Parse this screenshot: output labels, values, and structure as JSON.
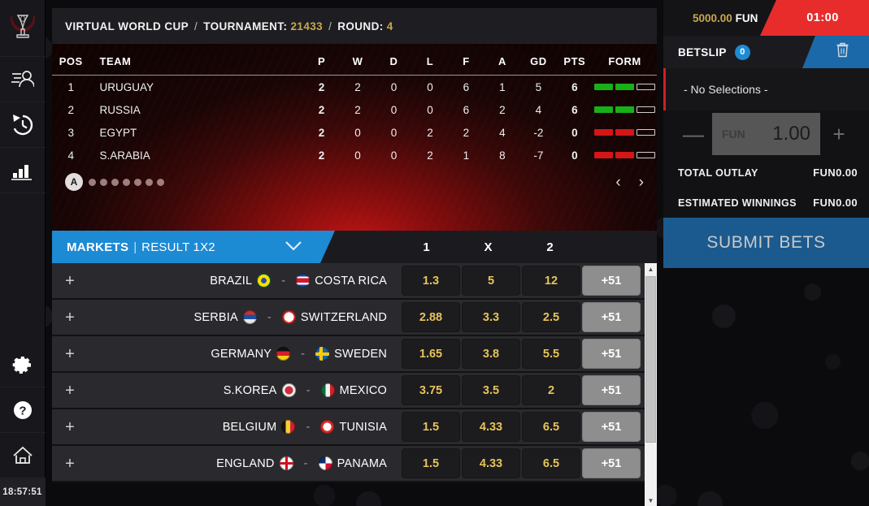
{
  "rail": {
    "items": [
      {
        "name": "trophy-icon",
        "label": "Virtual World Cup"
      },
      {
        "name": "lineups-icon",
        "label": "Line Ups"
      },
      {
        "name": "history-icon",
        "label": "History"
      },
      {
        "name": "statistics-icon",
        "label": "Statistics"
      },
      {
        "name": "settings-icon",
        "label": "Settings"
      },
      {
        "name": "help-icon",
        "label": "Help"
      },
      {
        "name": "home-icon",
        "label": "Home"
      }
    ],
    "clock": "18:57:51"
  },
  "header": {
    "title": "VIRTUAL WORLD CUP",
    "sep": "/",
    "tournament_label": "TOURNAMENT:",
    "tournament_value": "21433",
    "round_label": "ROUND:",
    "round_value": "4"
  },
  "account": {
    "balance": "5000.00",
    "currency": "FUN",
    "timer": "01:00"
  },
  "standings": {
    "columns": [
      "POS",
      "TEAM",
      "P",
      "W",
      "D",
      "L",
      "F",
      "A",
      "GD",
      "PTS",
      "FORM"
    ],
    "rows": [
      {
        "pos": "1",
        "team": "URUGUAY",
        "p": "2",
        "w": "2",
        "d": "0",
        "l": "0",
        "f": "6",
        "a": "1",
        "gd": "5",
        "pts": "6",
        "form": [
          "W",
          "W",
          "E"
        ]
      },
      {
        "pos": "2",
        "team": "RUSSIA",
        "p": "2",
        "w": "2",
        "d": "0",
        "l": "0",
        "f": "6",
        "a": "2",
        "gd": "4",
        "pts": "6",
        "form": [
          "W",
          "W",
          "E"
        ]
      },
      {
        "pos": "3",
        "team": "EGYPT",
        "p": "2",
        "w": "0",
        "d": "0",
        "l": "2",
        "f": "2",
        "a": "4",
        "gd": "-2",
        "pts": "0",
        "form": [
          "L",
          "L",
          "E"
        ]
      },
      {
        "pos": "4",
        "team": "S.ARABIA",
        "p": "2",
        "w": "0",
        "d": "0",
        "l": "2",
        "f": "1",
        "a": "8",
        "gd": "-7",
        "pts": "0",
        "form": [
          "L",
          "L",
          "E"
        ]
      }
    ],
    "group_active": "A",
    "group_dots": 7,
    "prev_label": "‹",
    "next_label": "›"
  },
  "markets": {
    "tab_label": "MARKETS",
    "pipe": "|",
    "market_name": "RESULT 1X2",
    "columns": [
      "1",
      "X",
      "2"
    ]
  },
  "matches": [
    {
      "home": "BRAZIL",
      "away": "COSTA RICA",
      "home_flag": "br",
      "away_flag": "cr",
      "odds": [
        "1.3",
        "5",
        "12"
      ],
      "more": "+51"
    },
    {
      "home": "SERBIA",
      "away": "SWITZERLAND",
      "home_flag": "rs",
      "away_flag": "ch",
      "odds": [
        "2.88",
        "3.3",
        "2.5"
      ],
      "more": "+51"
    },
    {
      "home": "GERMANY",
      "away": "SWEDEN",
      "home_flag": "de",
      "away_flag": "se",
      "odds": [
        "1.65",
        "3.8",
        "5.5"
      ],
      "more": "+51"
    },
    {
      "home": "S.KOREA",
      "away": "MEXICO",
      "home_flag": "kr",
      "away_flag": "mx",
      "odds": [
        "3.75",
        "3.5",
        "2"
      ],
      "more": "+51"
    },
    {
      "home": "BELGIUM",
      "away": "TUNISIA",
      "home_flag": "be",
      "away_flag": "tn",
      "odds": [
        "1.5",
        "4.33",
        "6.5"
      ],
      "more": "+51"
    },
    {
      "home": "ENGLAND",
      "away": "PANAMA",
      "home_flag": "en",
      "away_flag": "pa",
      "odds": [
        "1.5",
        "4.33",
        "6.5"
      ],
      "more": "+51"
    }
  ],
  "betslip": {
    "title": "BETSLIP",
    "count": "0",
    "empty_text": "- No Selections -",
    "stake_currency": "FUN",
    "stake_value": "1.00",
    "minus": "—",
    "plus": "+",
    "total_outlay_label": "TOTAL OUTLAY",
    "total_outlay_value": "FUN0.00",
    "estimated_winnings_label": "ESTIMATED WINNINGS",
    "estimated_winnings_value": "FUN0.00",
    "submit_label": "SUBMIT BETS"
  },
  "colors": {
    "accent_blue": "#1d8ad4",
    "odds_gold": "#e7c35b",
    "timer_red": "#e82c2c",
    "balance_gold": "#c8a84b",
    "win_green": "#17b117",
    "loss_red": "#d41616"
  }
}
